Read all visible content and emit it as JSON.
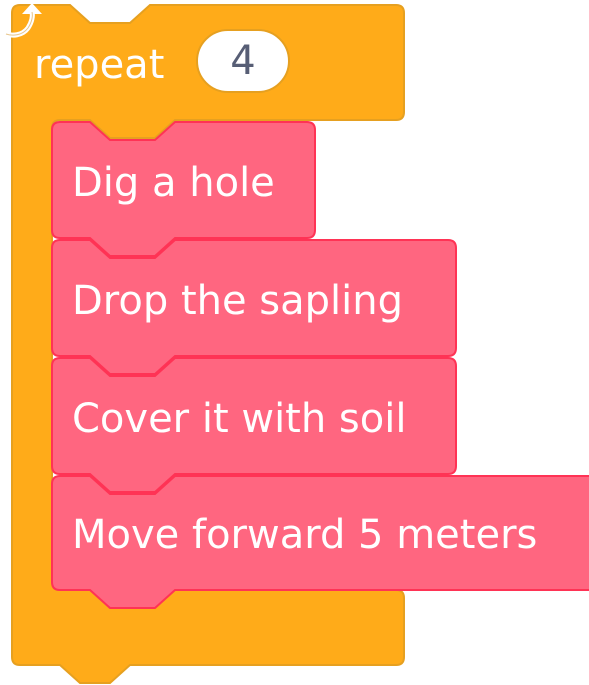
{
  "repeat_block": {
    "label": "repeat",
    "count": "4",
    "color": "#ffab19",
    "border": "#e6a020",
    "loop_icon": "loop-arrow-icon"
  },
  "steps": [
    {
      "label": "Dig a hole"
    },
    {
      "label": "Drop the sapling"
    },
    {
      "label": "Cover it with soil"
    },
    {
      "label": "Move forward 5 meters"
    }
  ],
  "step_color": "#ff6680",
  "step_border": "#ff3355"
}
